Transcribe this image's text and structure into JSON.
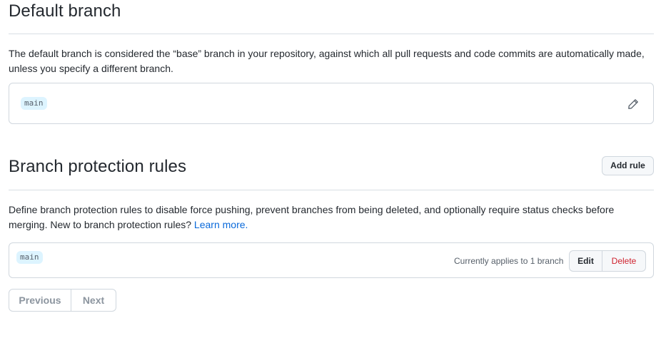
{
  "default_branch": {
    "heading": "Default branch",
    "description": "The default branch is considered the “base” branch in your repository, against which all pull requests and code commits are automatically made, unless you specify a different branch.",
    "branch_name": "main",
    "edit_icon": "pencil-icon"
  },
  "protection": {
    "heading": "Branch protection rules",
    "add_rule_label": "Add rule",
    "description": "Define branch protection rules to disable force pushing, prevent branches from being deleted, and optionally require status checks before merging. New to branch protection rules?",
    "learn_more": "Learn more.",
    "rules": [
      {
        "pattern": "main",
        "applies": "Currently applies to 1 branch",
        "edit_label": "Edit",
        "delete_label": "Delete"
      }
    ]
  },
  "pagination": {
    "previous": "Previous",
    "next": "Next"
  },
  "colors": {
    "link": "#0969da",
    "danger": "#cf222e",
    "code_bg": "#ddf4ff",
    "border": "#d0d7de"
  }
}
